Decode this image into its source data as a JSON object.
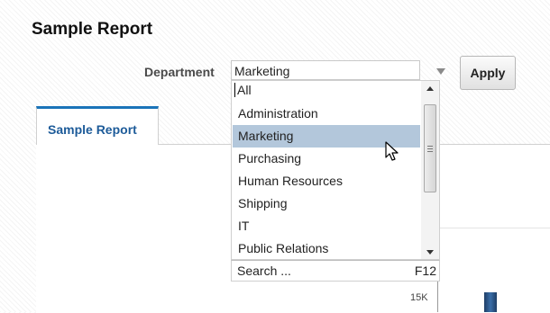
{
  "report": {
    "title": "Sample Report"
  },
  "prompt": {
    "label": "Department",
    "selected_value": "Marketing",
    "apply_label": "Apply"
  },
  "tabs": [
    {
      "label": "Sample Report",
      "active": true
    }
  ],
  "dropdown": {
    "typed_text": "All",
    "options": [
      "Administration",
      "Marketing",
      "Purchasing",
      "Human Resources",
      "Shipping",
      "IT",
      "Public Relations"
    ],
    "highlighted": "Marketing",
    "search_label": "Search ...",
    "search_shortcut": "F12"
  },
  "chart": {
    "visible_tick": "15K"
  },
  "colors": {
    "tab_accent": "#1a73b8",
    "tab_text": "#1d5b99",
    "highlight": "#b3c7db",
    "bar": "#2a5788"
  }
}
